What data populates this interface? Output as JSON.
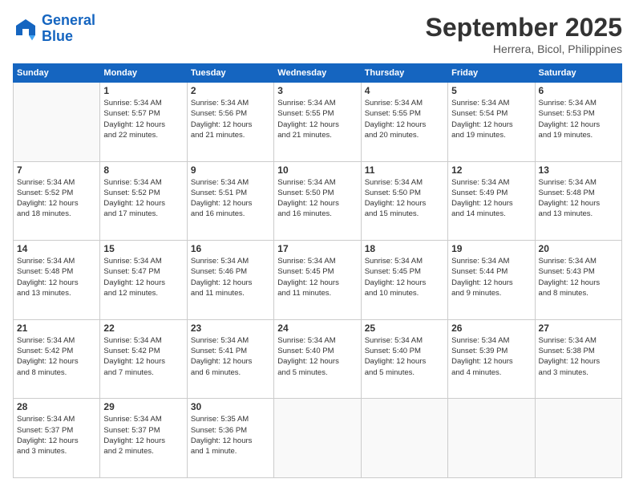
{
  "logo": {
    "line1": "General",
    "line2": "Blue"
  },
  "title": "September 2025",
  "subtitle": "Herrera, Bicol, Philippines",
  "headers": [
    "Sunday",
    "Monday",
    "Tuesday",
    "Wednesday",
    "Thursday",
    "Friday",
    "Saturday"
  ],
  "weeks": [
    [
      {
        "day": "",
        "info": ""
      },
      {
        "day": "1",
        "info": "Sunrise: 5:34 AM\nSunset: 5:57 PM\nDaylight: 12 hours\nand 22 minutes."
      },
      {
        "day": "2",
        "info": "Sunrise: 5:34 AM\nSunset: 5:56 PM\nDaylight: 12 hours\nand 21 minutes."
      },
      {
        "day": "3",
        "info": "Sunrise: 5:34 AM\nSunset: 5:55 PM\nDaylight: 12 hours\nand 21 minutes."
      },
      {
        "day": "4",
        "info": "Sunrise: 5:34 AM\nSunset: 5:55 PM\nDaylight: 12 hours\nand 20 minutes."
      },
      {
        "day": "5",
        "info": "Sunrise: 5:34 AM\nSunset: 5:54 PM\nDaylight: 12 hours\nand 19 minutes."
      },
      {
        "day": "6",
        "info": "Sunrise: 5:34 AM\nSunset: 5:53 PM\nDaylight: 12 hours\nand 19 minutes."
      }
    ],
    [
      {
        "day": "7",
        "info": "Sunrise: 5:34 AM\nSunset: 5:52 PM\nDaylight: 12 hours\nand 18 minutes."
      },
      {
        "day": "8",
        "info": "Sunrise: 5:34 AM\nSunset: 5:52 PM\nDaylight: 12 hours\nand 17 minutes."
      },
      {
        "day": "9",
        "info": "Sunrise: 5:34 AM\nSunset: 5:51 PM\nDaylight: 12 hours\nand 16 minutes."
      },
      {
        "day": "10",
        "info": "Sunrise: 5:34 AM\nSunset: 5:50 PM\nDaylight: 12 hours\nand 16 minutes."
      },
      {
        "day": "11",
        "info": "Sunrise: 5:34 AM\nSunset: 5:50 PM\nDaylight: 12 hours\nand 15 minutes."
      },
      {
        "day": "12",
        "info": "Sunrise: 5:34 AM\nSunset: 5:49 PM\nDaylight: 12 hours\nand 14 minutes."
      },
      {
        "day": "13",
        "info": "Sunrise: 5:34 AM\nSunset: 5:48 PM\nDaylight: 12 hours\nand 13 minutes."
      }
    ],
    [
      {
        "day": "14",
        "info": "Sunrise: 5:34 AM\nSunset: 5:48 PM\nDaylight: 12 hours\nand 13 minutes."
      },
      {
        "day": "15",
        "info": "Sunrise: 5:34 AM\nSunset: 5:47 PM\nDaylight: 12 hours\nand 12 minutes."
      },
      {
        "day": "16",
        "info": "Sunrise: 5:34 AM\nSunset: 5:46 PM\nDaylight: 12 hours\nand 11 minutes."
      },
      {
        "day": "17",
        "info": "Sunrise: 5:34 AM\nSunset: 5:45 PM\nDaylight: 12 hours\nand 11 minutes."
      },
      {
        "day": "18",
        "info": "Sunrise: 5:34 AM\nSunset: 5:45 PM\nDaylight: 12 hours\nand 10 minutes."
      },
      {
        "day": "19",
        "info": "Sunrise: 5:34 AM\nSunset: 5:44 PM\nDaylight: 12 hours\nand 9 minutes."
      },
      {
        "day": "20",
        "info": "Sunrise: 5:34 AM\nSunset: 5:43 PM\nDaylight: 12 hours\nand 8 minutes."
      }
    ],
    [
      {
        "day": "21",
        "info": "Sunrise: 5:34 AM\nSunset: 5:42 PM\nDaylight: 12 hours\nand 8 minutes."
      },
      {
        "day": "22",
        "info": "Sunrise: 5:34 AM\nSunset: 5:42 PM\nDaylight: 12 hours\nand 7 minutes."
      },
      {
        "day": "23",
        "info": "Sunrise: 5:34 AM\nSunset: 5:41 PM\nDaylight: 12 hours\nand 6 minutes."
      },
      {
        "day": "24",
        "info": "Sunrise: 5:34 AM\nSunset: 5:40 PM\nDaylight: 12 hours\nand 5 minutes."
      },
      {
        "day": "25",
        "info": "Sunrise: 5:34 AM\nSunset: 5:40 PM\nDaylight: 12 hours\nand 5 minutes."
      },
      {
        "day": "26",
        "info": "Sunrise: 5:34 AM\nSunset: 5:39 PM\nDaylight: 12 hours\nand 4 minutes."
      },
      {
        "day": "27",
        "info": "Sunrise: 5:34 AM\nSunset: 5:38 PM\nDaylight: 12 hours\nand 3 minutes."
      }
    ],
    [
      {
        "day": "28",
        "info": "Sunrise: 5:34 AM\nSunset: 5:37 PM\nDaylight: 12 hours\nand 3 minutes."
      },
      {
        "day": "29",
        "info": "Sunrise: 5:34 AM\nSunset: 5:37 PM\nDaylight: 12 hours\nand 2 minutes."
      },
      {
        "day": "30",
        "info": "Sunrise: 5:35 AM\nSunset: 5:36 PM\nDaylight: 12 hours\nand 1 minute."
      },
      {
        "day": "",
        "info": ""
      },
      {
        "day": "",
        "info": ""
      },
      {
        "day": "",
        "info": ""
      },
      {
        "day": "",
        "info": ""
      }
    ]
  ]
}
